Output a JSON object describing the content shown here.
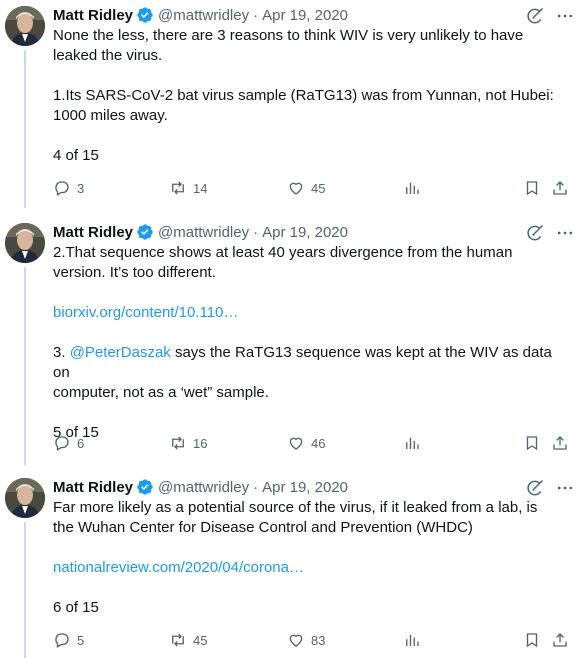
{
  "tweets": [
    {
      "author": "Matt Ridley",
      "handle": "@mattwridley",
      "separator": "·",
      "date": "Apr 19, 2020",
      "lines": [
        "None the less, there are 3 reasons to think WIV is very unlikely to have",
        "leaked the virus.",
        "1.Its SARS-CoV-2 bat virus sample (RaTG13) was from Yunnan, not Hubei:",
        "1000 miles away.",
        "4 of 15"
      ],
      "replies": "3",
      "retweets": "14",
      "likes": "45"
    },
    {
      "author": "Matt Ridley",
      "handle": "@mattwridley",
      "separator": "·",
      "date": "Apr 19, 2020",
      "lines": [
        "2.That sequence shows at least 40 years divergence from the human",
        "version. It’s too different.",
        "biorxiv.org/content/10.110…",
        "@PeterDaszak",
        " says the RaTG13 sequence was kept at the WIV as data on",
        "computer, not as a ‘wet” sample.",
        "5 of 15",
        "3. "
      ],
      "replies": "6",
      "retweets": "16",
      "likes": "46"
    },
    {
      "author": "Matt Ridley",
      "handle": "@mattwridley",
      "separator": "·",
      "date": "Apr 19, 2020",
      "lines": [
        "Far more likely as a potential source of the virus, if it leaked from a lab, is",
        "the Wuhan Center for Disease Control and Prevention (WHDC)",
        "nationalreview.com/2020/04/corona…",
        "6 of 15"
      ],
      "replies": "5",
      "retweets": "45",
      "likes": "83"
    }
  ],
  "colors": {
    "accent": "#1d9bf0",
    "text": "#0f1419",
    "muted": "#536471",
    "line": "#cfd9de"
  }
}
